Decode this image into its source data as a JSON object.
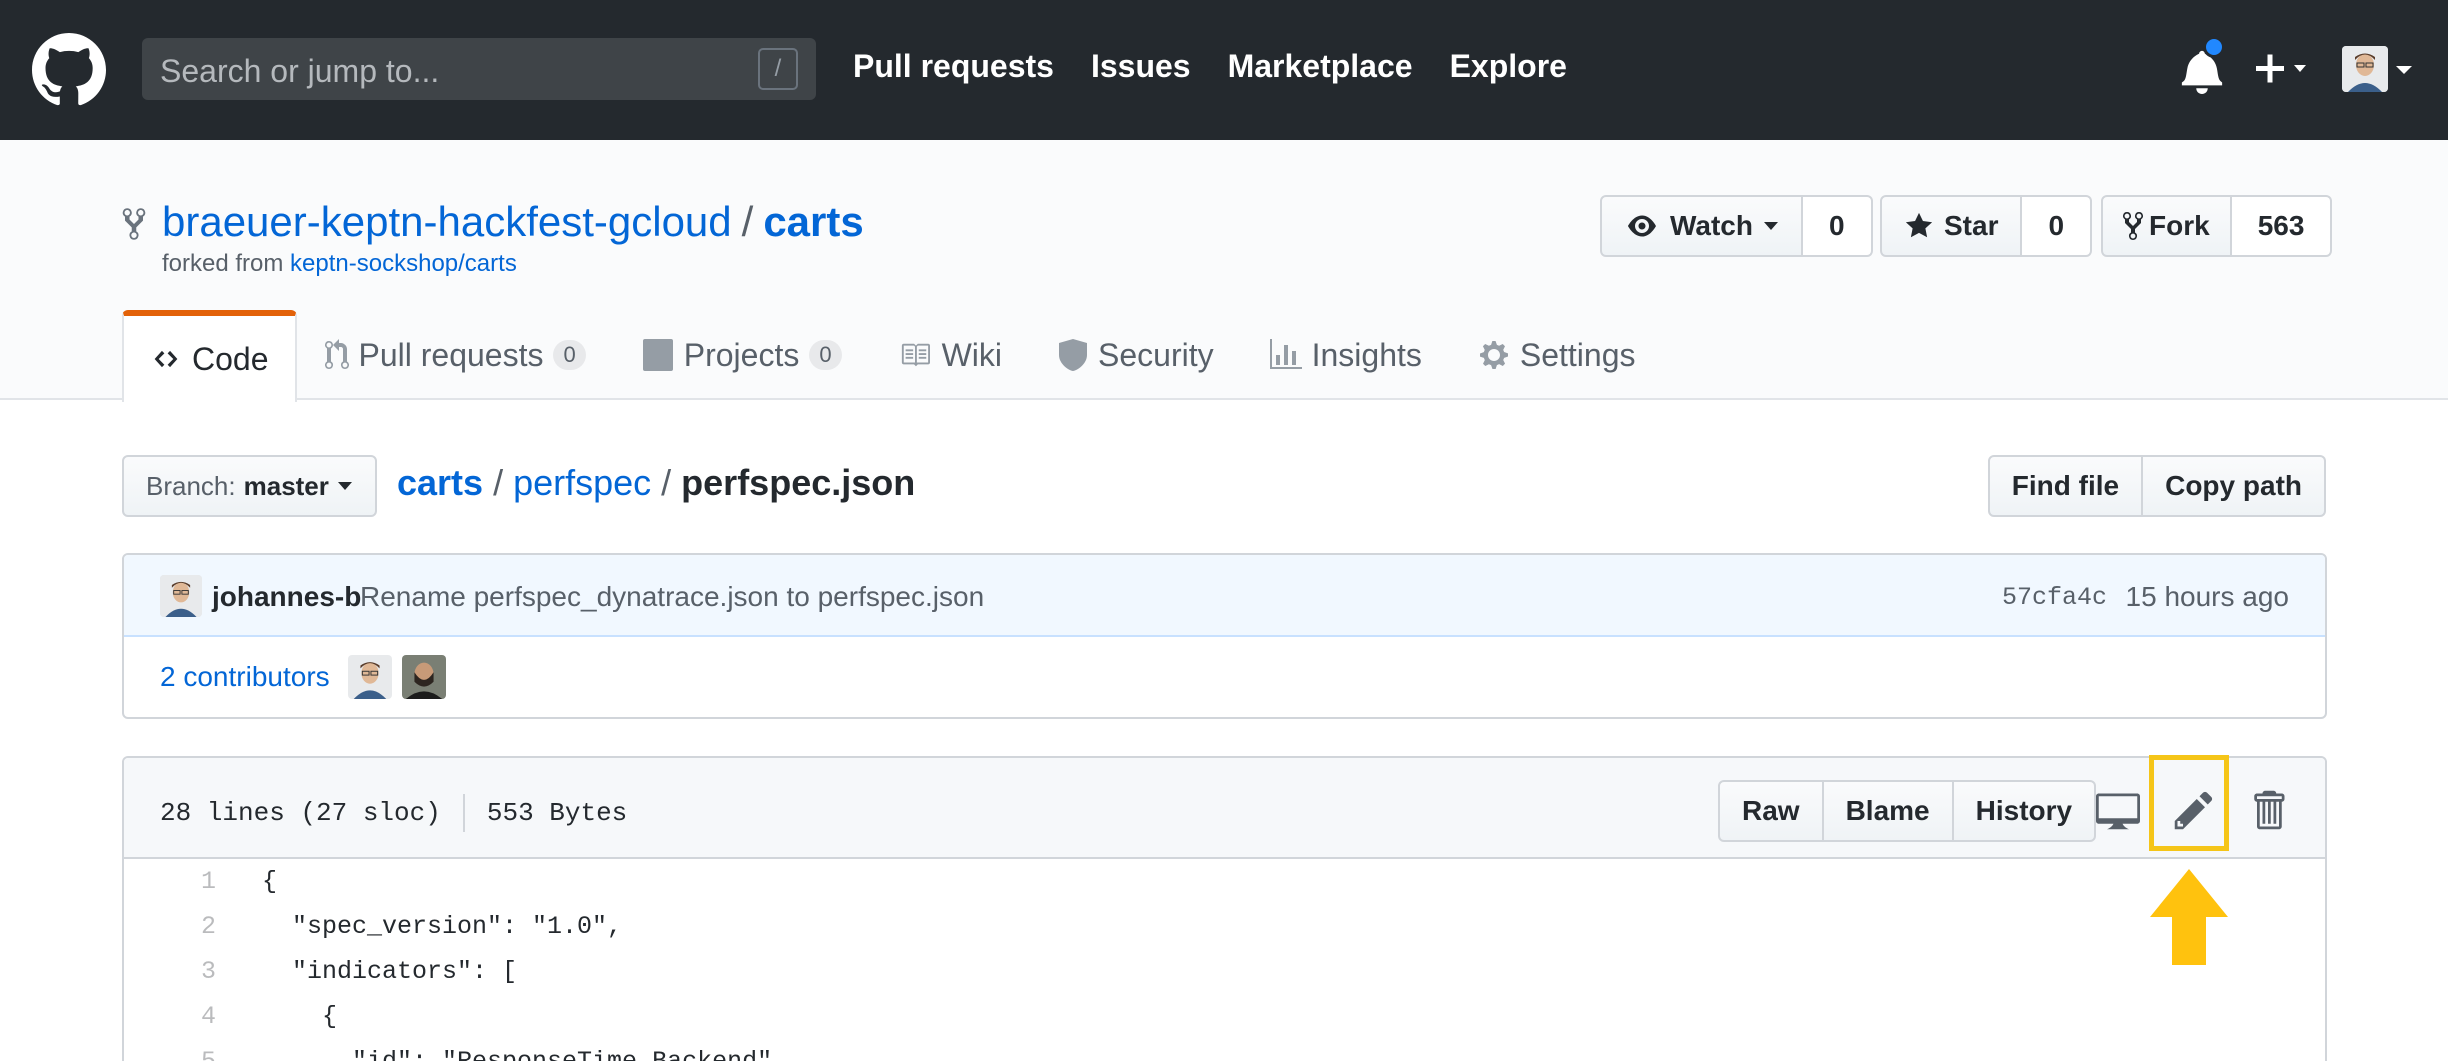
{
  "header": {
    "search_placeholder": "Search or jump to...",
    "search_shortcut": "/",
    "nav": [
      "Pull requests",
      "Issues",
      "Marketplace",
      "Explore"
    ],
    "icons": [
      "github-logo-icon",
      "bell-icon",
      "plus-icon",
      "avatar"
    ],
    "notification_color": "#2188ff"
  },
  "repo": {
    "owner": "braeuer-keptn-hackfest-gcloud",
    "separator": "/",
    "name": "carts",
    "forked_prefix": "forked from",
    "forked_source": "keptn-sockshop/carts",
    "watch_label": "Watch",
    "watch_count": "0",
    "star_label": "Star",
    "star_count": "0",
    "fork_label": "Fork",
    "fork_count": "563"
  },
  "tabs": [
    {
      "label": "Code",
      "icon": "code-icon",
      "selected": true
    },
    {
      "label": "Pull requests",
      "counter": "0",
      "icon": "pull-request-icon"
    },
    {
      "label": "Projects",
      "counter": "0",
      "icon": "project-icon"
    },
    {
      "label": "Wiki",
      "icon": "book-icon"
    },
    {
      "label": "Security",
      "icon": "shield-icon"
    },
    {
      "label": "Insights",
      "icon": "graph-icon"
    },
    {
      "label": "Settings",
      "icon": "gear-icon"
    }
  ],
  "filenav": {
    "branch_prefix": "Branch:",
    "branch": "master",
    "breadcrumb": [
      "carts",
      "perfspec"
    ],
    "breadcrumb_sep": "/",
    "filename": "perfspec.json",
    "find_file": "Find file",
    "copy_path": "Copy path"
  },
  "commit": {
    "author": "johannes-b",
    "message": "Rename perfspec_dynatrace.json to perfspec.json",
    "sha": "57cfa4c",
    "time": "15 hours ago",
    "contributors": "2 contributors"
  },
  "file": {
    "lines_info": "28 lines (27 sloc)",
    "size": "553 Bytes",
    "raw": "Raw",
    "blame": "Blame",
    "history": "History",
    "icons": [
      "desktop-icon",
      "pencil-icon",
      "trashcan-icon"
    ],
    "code": [
      {
        "n": "1",
        "text": "{"
      },
      {
        "n": "2",
        "text": "  \"spec_version\": \"1.0\","
      },
      {
        "n": "3",
        "text": "  \"indicators\": ["
      },
      {
        "n": "4",
        "text": "    {"
      },
      {
        "n": "5",
        "text": "      \"id\": \"ResponseTime_Backend\","
      }
    ]
  },
  "annotation": {
    "highlight_color": "#f5c518",
    "arrow_color": "#ffc20e",
    "target": "edit-file-button"
  },
  "colors": {
    "header_bg": "#24292e",
    "link": "#0366d6",
    "tab_accent": "#e36209",
    "commit_bg": "#f1f8ff"
  }
}
